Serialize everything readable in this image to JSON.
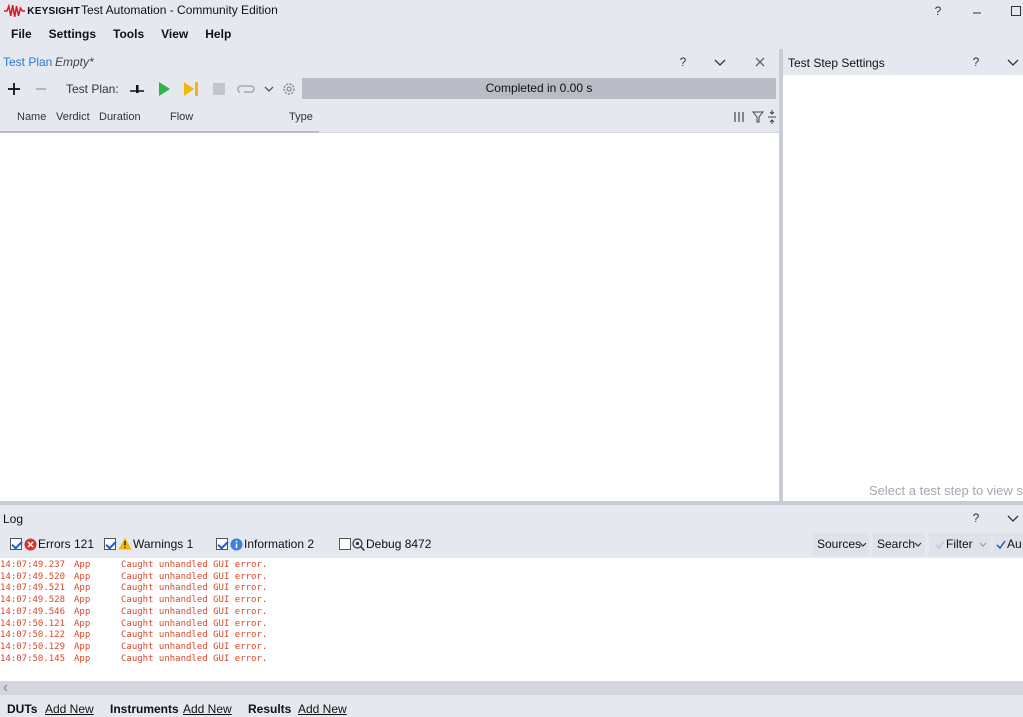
{
  "app": {
    "brand": "KEYSIGHT",
    "title": "Test Automation - Community Edition",
    "help_glyph": "?",
    "brand_color": "#d21f2b"
  },
  "menu": [
    "File",
    "Settings",
    "Tools",
    "View",
    "Help"
  ],
  "test_plan": {
    "tab_label": "Test Plan",
    "name": "Empty*",
    "toolbar_label": "Test Plan:",
    "status": "Completed in 0.00 s",
    "help_glyph": "?",
    "accent": "#2a79d6",
    "columns": [
      "Name",
      "Verdict",
      "Duration",
      "Flow",
      "Type"
    ]
  },
  "step_settings": {
    "title": "Test Step Settings",
    "help_glyph": "?",
    "hint": "Select a test step to view s"
  },
  "log": {
    "title": "Log",
    "help_glyph": "?",
    "filters": {
      "errors": "Errors 121",
      "warnings": "Warnings 1",
      "information": "Information 2",
      "debug": "Debug 8472"
    },
    "buttons": {
      "sources": "Sources",
      "search": "Search",
      "filter": "Filter",
      "auto": "Au"
    },
    "error_color": "#d9472b",
    "rows": [
      {
        "time": "14:07:49.237",
        "source": "App",
        "message": "Caught unhandled GUI error."
      },
      {
        "time": "14:07:49.520",
        "source": "App",
        "message": "Caught unhandled GUI error."
      },
      {
        "time": "14:07:49.521",
        "source": "App",
        "message": "Caught unhandled GUI error."
      },
      {
        "time": "14:07:49.528",
        "source": "App",
        "message": "Caught unhandled GUI error."
      },
      {
        "time": "14:07:49.546",
        "source": "App",
        "message": "Caught unhandled GUI error."
      },
      {
        "time": "14:07:50.121",
        "source": "App",
        "message": "Caught unhandled GUI error."
      },
      {
        "time": "14:07:50.122",
        "source": "App",
        "message": "Caught unhandled GUI error."
      },
      {
        "time": "14:07:50.129",
        "source": "App",
        "message": "Caught unhandled GUI error."
      },
      {
        "time": "14:07:50.145",
        "source": "App",
        "message": "Caught unhandled GUI error."
      }
    ]
  },
  "bottom_bar": {
    "duts": "DUTs",
    "instruments": "Instruments",
    "results": "Results",
    "add_new": "Add New"
  }
}
